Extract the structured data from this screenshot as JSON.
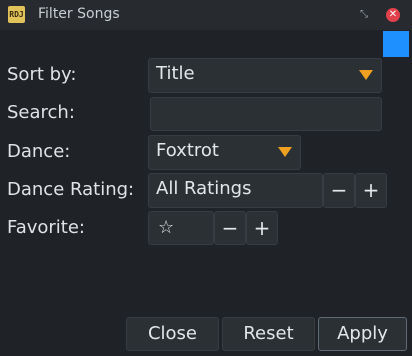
{
  "window": {
    "title": "Filter Songs",
    "app_icon_text": "RDJ",
    "icons": {
      "minmax": "restore-icon",
      "close": "close-icon"
    },
    "accent_color": "#1e90ff"
  },
  "form": {
    "sort_by": {
      "label": "Sort by:",
      "value": "Title"
    },
    "search": {
      "label": "Search:",
      "value": ""
    },
    "dance": {
      "label": "Dance:",
      "value": "Foxtrot"
    },
    "dance_rating": {
      "label": "Dance Rating:",
      "value": "All Ratings",
      "minus": "−",
      "plus": "+"
    },
    "favorite": {
      "label": "Favorite:",
      "star": "☆",
      "minus": "−",
      "plus": "+"
    }
  },
  "buttons": {
    "close": "Close",
    "reset": "Reset",
    "apply": "Apply"
  }
}
